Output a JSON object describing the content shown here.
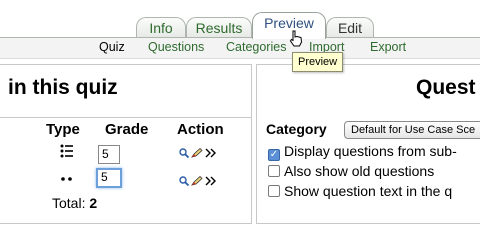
{
  "tabs": [
    {
      "label": "Info",
      "selected": false
    },
    {
      "label": "Results",
      "selected": false
    },
    {
      "label": "Preview",
      "selected": true
    },
    {
      "label": "Edit",
      "selected": false
    }
  ],
  "subtabs": {
    "quiz": "Quiz",
    "questions": "Questions",
    "categories": "Categories",
    "import": "Import",
    "export": "Export"
  },
  "tooltip": "Preview",
  "left": {
    "title": "in this quiz",
    "headers": {
      "type": "Type",
      "grade": "Grade",
      "action": "Action"
    },
    "rows": [
      {
        "grade": "5",
        "type_icon": "multichoice-icon"
      },
      {
        "grade": "5",
        "type_icon": "matching-icon"
      }
    ],
    "total_label": "Total:",
    "total_value": "2"
  },
  "right": {
    "title": "Quest",
    "category_label": "Category",
    "category_value": "Default for Use Case Sce",
    "options": [
      {
        "label": "Display questions from sub-",
        "checked": true
      },
      {
        "label": "Also show old questions",
        "checked": false
      },
      {
        "label": "Show question text in the q",
        "checked": false
      }
    ]
  },
  "colors": {
    "tab_text": "#2f6b2f",
    "accent": "#5b8fd6",
    "tooltip_bg": "#ffffcf"
  }
}
